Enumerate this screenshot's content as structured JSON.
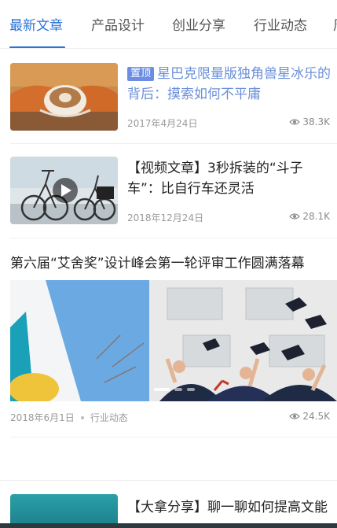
{
  "tabs": [
    {
      "label": "最新文章",
      "active": true
    },
    {
      "label": "产品设计",
      "active": false
    },
    {
      "label": "创业分享",
      "active": false
    },
    {
      "label": "行业动态",
      "active": false
    },
    {
      "label": "周",
      "active": false
    }
  ],
  "articles": [
    {
      "badge": "置顶",
      "title": "星巴克限量版独角兽星冰乐的背后：摸索如何不平庸",
      "date": "2017年4月24日",
      "views": "38.3K",
      "image": "latte-art-cup"
    },
    {
      "title": "【视频文章】3秒拆装的“斗子车”：比自行车还灵活",
      "date": "2018年12月24日",
      "views": "28.1K",
      "image": "folding-bicycles"
    }
  ],
  "featured": {
    "title": "第六届“艾舍奖”设计峰会第一轮评审工作圆满落幕",
    "date": "2018年6月1日",
    "category": "行业动态",
    "views": "24.5K",
    "slides": 3,
    "active_slide": 0
  },
  "next_article": {
    "title": "【大拿分享】聊一聊如何提高文能"
  },
  "colors": {
    "accent": "#2a73d9",
    "badge": "#6b8ee3",
    "highlight_title": "#6a8fd9"
  }
}
